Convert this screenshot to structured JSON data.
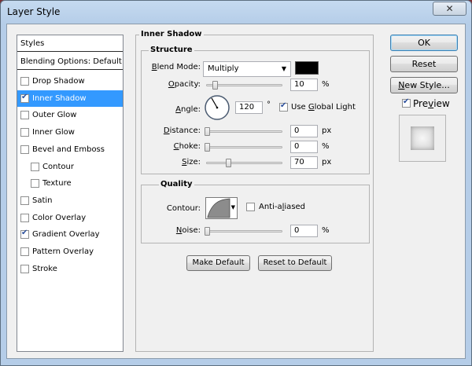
{
  "window": {
    "title": "Layer Style",
    "close_glyph": "✕"
  },
  "styles_list": {
    "header": "Styles",
    "blending": "Blending Options: Default",
    "items": [
      {
        "label": "Drop Shadow",
        "checked": false,
        "indent": false,
        "selected": false
      },
      {
        "label": "Inner Shadow",
        "checked": true,
        "indent": false,
        "selected": true
      },
      {
        "label": "Outer Glow",
        "checked": false,
        "indent": false,
        "selected": false
      },
      {
        "label": "Inner Glow",
        "checked": false,
        "indent": false,
        "selected": false
      },
      {
        "label": "Bevel and Emboss",
        "checked": false,
        "indent": false,
        "selected": false
      },
      {
        "label": "Contour",
        "checked": false,
        "indent": true,
        "selected": false
      },
      {
        "label": "Texture",
        "checked": false,
        "indent": true,
        "selected": false
      },
      {
        "label": "Satin",
        "checked": false,
        "indent": false,
        "selected": false
      },
      {
        "label": "Color Overlay",
        "checked": false,
        "indent": false,
        "selected": false
      },
      {
        "label": "Gradient Overlay",
        "checked": true,
        "indent": false,
        "selected": false
      },
      {
        "label": "Pattern Overlay",
        "checked": false,
        "indent": false,
        "selected": false
      },
      {
        "label": "Stroke",
        "checked": false,
        "indent": false,
        "selected": false
      }
    ]
  },
  "inner_shadow": {
    "title": "Inner Shadow",
    "structure": {
      "title": "Structure",
      "blend_mode_label": "Blend Mode:",
      "blend_mode_value": "Multiply",
      "shadow_color": "#000000",
      "opacity_label": "Opacity:",
      "opacity_value": "10",
      "opacity_unit": "%",
      "opacity_fraction": 0.1,
      "angle_label": "Angle:",
      "angle_value": "120",
      "angle_unit": "°",
      "angle_degrees": 120,
      "global_light_label": "Use Global Light",
      "global_light_checked": true,
      "distance_label": "Distance:",
      "distance_value": "0",
      "distance_unit": "px",
      "distance_fraction": 0.0,
      "choke_label": "Choke:",
      "choke_value": "0",
      "choke_unit": "%",
      "choke_fraction": 0.0,
      "size_label": "Size:",
      "size_value": "70",
      "size_unit": "px",
      "size_fraction": 0.28
    },
    "quality": {
      "title": "Quality",
      "contour_label": "Contour:",
      "anti_aliased_label": "Anti-aliased",
      "anti_aliased_checked": false,
      "noise_label": "Noise:",
      "noise_value": "0",
      "noise_unit": "%",
      "noise_fraction": 0.0
    },
    "make_default": "Make Default",
    "reset_default": "Reset to Default"
  },
  "buttons": {
    "ok": "OK",
    "reset": "Reset",
    "new_style": "New Style...",
    "preview_label": "Preview",
    "preview_checked": true
  }
}
